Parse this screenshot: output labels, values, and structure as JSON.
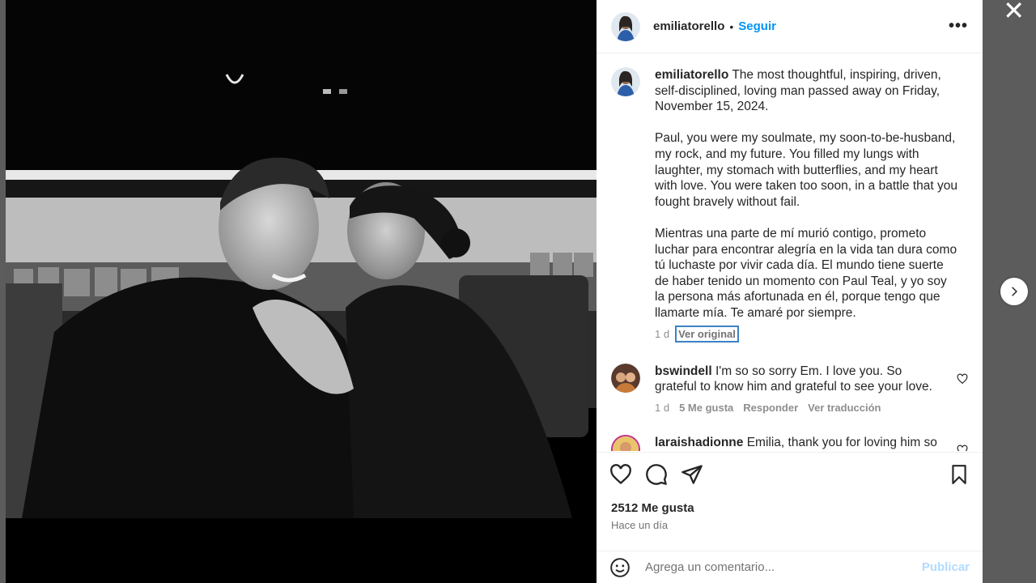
{
  "post": {
    "author": "emiliatorello",
    "separator": "•",
    "follow_label": "Seguir",
    "more_label": "•••",
    "caption": {
      "username": "emiliatorello",
      "para1": "The most thoughtful, inspiring, driven, self-disciplined, loving man passed away on Friday, November 15, 2024.",
      "para2": "Paul, you were my soulmate, my soon-to-be-husband, my rock, and my future. You filled my lungs with laughter, my stomach with butterflies, and my heart with love. You were taken too soon, in a battle that you fought bravely without fail.",
      "para3": "Mientras una parte de mí murió contigo, prometo luchar para encontrar alegría en la vida tan dura como tú luchaste por vivir cada día. El mundo tiene suerte de haber tenido un momento con Paul Teal, y yo soy la persona más afortunada en él, porque tengo que llamarte mía. Te amaré por siempre.",
      "age": "1 d",
      "see_original": "Ver original"
    },
    "comments": [
      {
        "username": "bswindell",
        "text": "I'm so so sorry Em. I love you. So grateful to know him and grateful to see your love.",
        "age": "1 d",
        "likes": "5 Me gusta",
        "reply": "Responder",
        "translate": "Ver traducción"
      },
      {
        "username": "laraishadionne",
        "text": "Emilia, thank you for loving him so"
      }
    ],
    "likes_count": "2512 Me gusta",
    "time_ago": "Hace un día",
    "composer": {
      "placeholder": "Agrega un comentario...",
      "publish_label": "Publicar"
    }
  },
  "controls": {
    "close": "✕"
  },
  "colors": {
    "accent": "#0095f6",
    "publish_disabled": "#b3dbff",
    "focus_ring": "#3b82c4"
  }
}
